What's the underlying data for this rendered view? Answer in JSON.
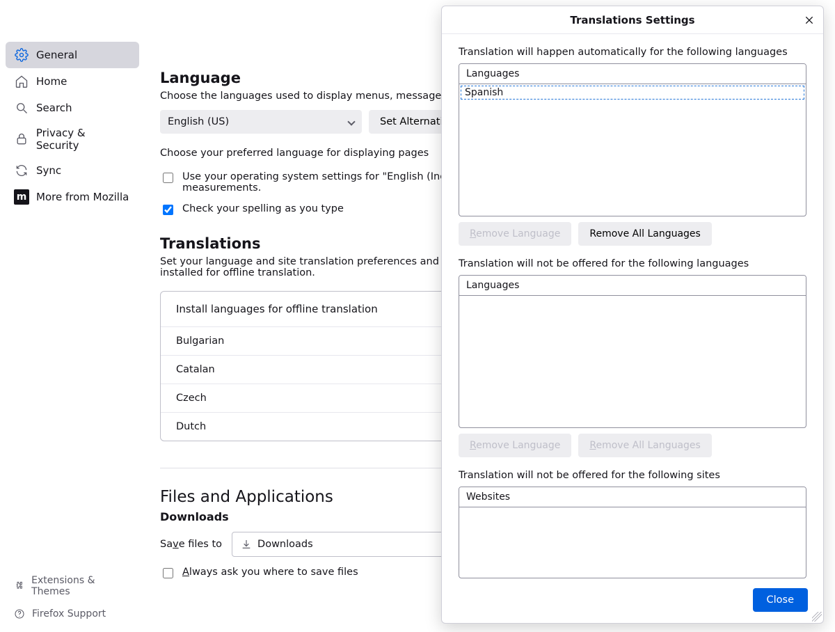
{
  "sidebar": {
    "items": [
      {
        "name": "general",
        "label": "General",
        "selected": true
      },
      {
        "name": "home",
        "label": "Home"
      },
      {
        "name": "search",
        "label": "Search"
      },
      {
        "name": "privacy",
        "label": "Privacy & Security"
      },
      {
        "name": "sync",
        "label": "Sync"
      },
      {
        "name": "more",
        "label": "More from Mozilla"
      }
    ],
    "footer": [
      {
        "name": "extensions",
        "label": "Extensions & Themes"
      },
      {
        "name": "support",
        "label": "Firefox Support"
      }
    ]
  },
  "language": {
    "title": "Language",
    "desc": "Choose the languages used to display menus, messages, and n",
    "select_value": "English (US)",
    "set_alt_btn": "Set Alternativ",
    "preferred_label": "Choose your preferred language for displaying pages",
    "use_os_label": "Use your operating system settings for \"English (India)\" to f",
    "use_os_label2": "measurements.",
    "use_os_checked": false,
    "spellcheck_label": "Check your spelling as you type",
    "spellcheck_checked": true
  },
  "translations": {
    "title": "Translations",
    "desc": "Set your language and site translation preferences and manag",
    "desc2": "installed for offline translation.",
    "install_header": "Install languages for offline translation",
    "lang_rows": [
      "Bulgarian",
      "Catalan",
      "Czech",
      "Dutch"
    ]
  },
  "files": {
    "title": "Files and Applications",
    "downloads_title": "Downloads",
    "save_label_pre": "Sa",
    "save_label_u": "v",
    "save_label_post": "e files to",
    "path_label": "Downloads",
    "ask_label_u": "A",
    "ask_label_post": "lways ask you where to save files",
    "ask_checked": false
  },
  "modal": {
    "title": "Translations Settings",
    "auto_label": "Translation will happen automatically for the following languages",
    "auto_header": "Languages",
    "auto_items": [
      "Spanish"
    ],
    "not_offered_lang_label": "Translation will not be offered for the following languages",
    "not_offered_lang_header": "Languages",
    "not_offered_lang_items": [],
    "not_offered_site_label": "Translation will not be offered for the following sites",
    "not_offered_site_header": "Websites",
    "not_offered_site_items": [],
    "remove_lang_btn_pre": "R",
    "remove_lang_btn_post": "emove Language",
    "remove_all_btn": "Remove All Languages",
    "remove_all_btn_u": "R",
    "remove_all_btn_post": "emove All Languages",
    "close_btn": "Close"
  }
}
